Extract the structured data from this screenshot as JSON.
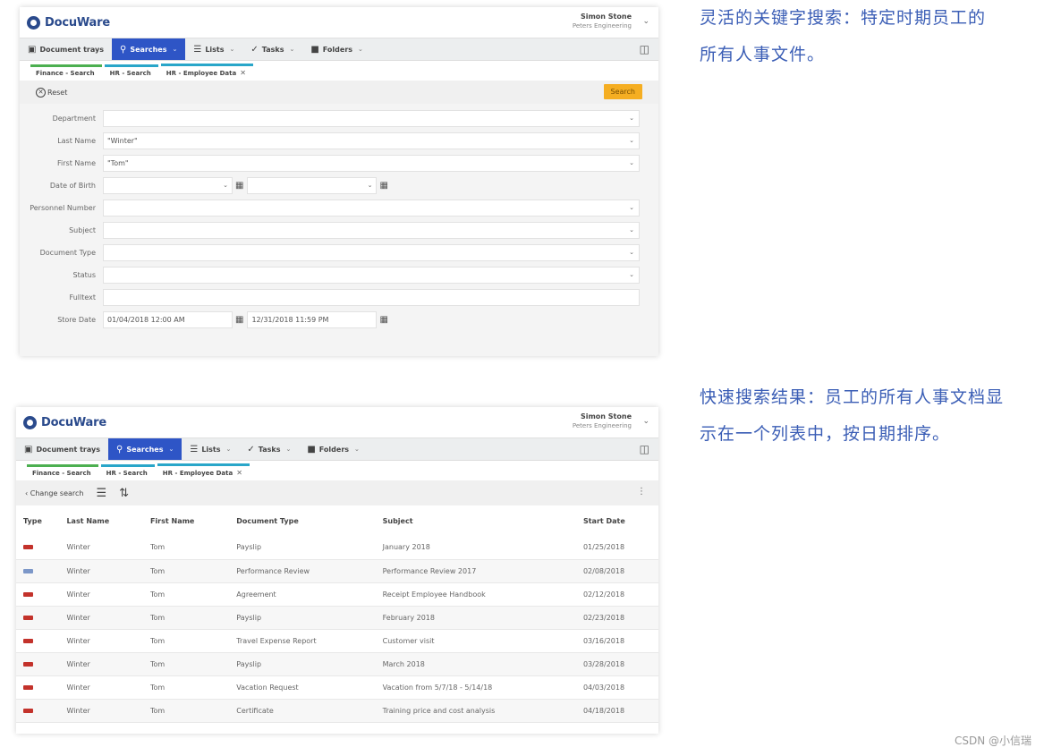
{
  "app": {
    "brand": "DocuWare"
  },
  "user": {
    "name": "Simon Stone",
    "org": "Peters Engineering"
  },
  "nav": [
    {
      "label": "Document trays",
      "icon": "tray-icon",
      "active": false
    },
    {
      "label": "Searches",
      "icon": "search-icon",
      "active": true
    },
    {
      "label": "Lists",
      "icon": "list-icon",
      "active": false
    },
    {
      "label": "Tasks",
      "icon": "check-icon",
      "active": false
    },
    {
      "label": "Folders",
      "icon": "folder-icon",
      "active": false
    }
  ],
  "tabs": [
    {
      "label": "Finance - Search"
    },
    {
      "label": "HR - Search"
    },
    {
      "label": "HR - Employee Data"
    }
  ],
  "search_form": {
    "reset_label": "Reset",
    "search_label": "Search",
    "fields": {
      "department": {
        "label": "Department",
        "value": ""
      },
      "last_name": {
        "label": "Last Name",
        "value": "\"Winter\""
      },
      "first_name": {
        "label": "First Name",
        "value": "\"Tom\""
      },
      "date_of_birth": {
        "label": "Date of Birth",
        "from": "",
        "to": ""
      },
      "personnel_number": {
        "label": "Personnel Number",
        "value": ""
      },
      "subject": {
        "label": "Subject",
        "value": ""
      },
      "document_type": {
        "label": "Document Type",
        "value": ""
      },
      "status": {
        "label": "Status",
        "value": ""
      },
      "fulltext": {
        "label": "Fulltext",
        "value": ""
      },
      "store_date": {
        "label": "Store Date",
        "from": "01/04/2018 12:00 AM",
        "to": "12/31/2018 11:59 PM"
      }
    }
  },
  "captions": {
    "first": "灵活的关键字搜索：特定时期员工的所有人事文件。",
    "second": "快速搜索结果：员工的所有人事文档显示在一个列表中，按日期排序。"
  },
  "results": {
    "change_search_label": "Change search",
    "columns": [
      "Type",
      "Last Name",
      "First Name",
      "Document Type",
      "Subject",
      "Start Date"
    ],
    "rows": [
      {
        "type": "pdf",
        "last": "Winter",
        "first": "Tom",
        "doctype": "Payslip",
        "subject": "January 2018",
        "date": "01/25/2018"
      },
      {
        "type": "word",
        "last": "Winter",
        "first": "Tom",
        "doctype": "Performance Review",
        "subject": "Performance Review 2017",
        "date": "02/08/2018"
      },
      {
        "type": "pdf",
        "last": "Winter",
        "first": "Tom",
        "doctype": "Agreement",
        "subject": "Receipt Employee Handbook",
        "date": "02/12/2018"
      },
      {
        "type": "pdf",
        "last": "Winter",
        "first": "Tom",
        "doctype": "Payslip",
        "subject": "February 2018",
        "date": "02/23/2018"
      },
      {
        "type": "pdf",
        "last": "Winter",
        "first": "Tom",
        "doctype": "Travel Expense Report",
        "subject": "Customer visit",
        "date": "03/16/2018"
      },
      {
        "type": "pdf",
        "last": "Winter",
        "first": "Tom",
        "doctype": "Payslip",
        "subject": "March 2018",
        "date": "03/28/2018"
      },
      {
        "type": "pdf",
        "last": "Winter",
        "first": "Tom",
        "doctype": "Vacation Request",
        "subject": "Vacation from 5/7/18 - 5/14/18",
        "date": "04/03/2018"
      },
      {
        "type": "pdf",
        "last": "Winter",
        "first": "Tom",
        "doctype": "Certificate",
        "subject": "Training price and cost analysis",
        "date": "04/18/2018"
      }
    ]
  },
  "watermark": "CSDN @小信瑞"
}
